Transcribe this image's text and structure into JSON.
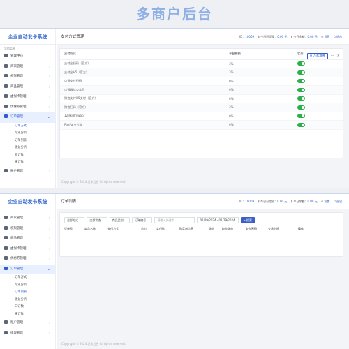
{
  "hero": {
    "title": "多商户后台"
  },
  "panel1": {
    "brand": "企业自动发卡系统",
    "nav_caption": "导航菜单",
    "nav": [
      {
        "label": "管理中心",
        "icon": "dashboard-icon",
        "chev": ""
      },
      {
        "label": "商家管理",
        "icon": "store-icon",
        "chev": "›"
      },
      {
        "label": "权限管理",
        "icon": "lock-icon",
        "chev": "›"
      },
      {
        "label": "商品管理",
        "icon": "box-icon",
        "chev": "›"
      },
      {
        "label": "虚拟卡管理",
        "icon": "card-icon",
        "chev": "›"
      },
      {
        "label": "优惠券管理",
        "icon": "coupon-icon",
        "chev": "›"
      },
      {
        "label": "订单管理",
        "icon": "order-icon",
        "chev": "⌄"
      }
    ],
    "sub": [
      "订单方式",
      "渠道分析",
      "订单列表",
      "收益分析",
      "日订数",
      "未订数"
    ],
    "nav_after": [
      {
        "label": "账户管理",
        "icon": "user-icon",
        "chev": "›"
      }
    ],
    "page_title": "支付方式管理",
    "topinfo": {
      "id_label": "ID：",
      "id_value": "10069",
      "profit_label": "$ 今日可提现：",
      "profit_value": "0.00 元",
      "balance_label": "$ 今日余额：",
      "balance_value": "0.00 元",
      "settings": "设置",
      "logout": "退出"
    },
    "add_button": "万家漏撞",
    "columns": [
      "支付方式",
      "平台税额",
      "状态"
    ],
    "rows": [
      {
        "name": "支付宝扫码（官方）",
        "fee": "3%"
      },
      {
        "name": "支付宝H5（官方）",
        "fee": "3%"
      },
      {
        "name": "点银支付扫码",
        "fee": "0%"
      },
      {
        "name": "点银微信公众号",
        "fee": "0%"
      },
      {
        "name": "微信支付H5支付（官方）",
        "fee": "0%"
      },
      {
        "name": "微信扫码（官方）",
        "fee": "3%"
      },
      {
        "name": "12lskj微Swap",
        "fee": "0%"
      },
      {
        "name": "PayPal支付宝",
        "fee": "0%"
      }
    ],
    "footer": "Copyright © 2024 发卡后台 All rights reserved."
  },
  "panel2": {
    "brand": "企业自动发卡系统",
    "nav": [
      {
        "label": "商家管理",
        "icon": "store-icon",
        "chev": "›"
      },
      {
        "label": "权限管理",
        "icon": "lock-icon",
        "chev": "›"
      },
      {
        "label": "商品管理",
        "icon": "box-icon",
        "chev": "›"
      },
      {
        "label": "虚拟卡管理",
        "icon": "card-icon",
        "chev": "›"
      },
      {
        "label": "优惠券管理",
        "icon": "coupon-icon",
        "chev": "›"
      },
      {
        "label": "订单管理",
        "icon": "order-icon",
        "chev": "⌄"
      }
    ],
    "sub": [
      "订单方式",
      "渠道分析",
      "订单列表",
      "收益分析",
      "日订数",
      "未订数"
    ],
    "nav_after": [
      {
        "label": "账户管理",
        "icon": "user-icon",
        "chev": "›"
      },
      {
        "label": "提现管理",
        "icon": "withdraw-icon",
        "chev": "›"
      }
    ],
    "page_title": "订单列表",
    "filters": {
      "pay_method": "全部方式",
      "status": "全部状态",
      "category": "商品类别",
      "order_no": "订单编号",
      "search_placeholder": "请输入关键字",
      "date_range": "01/29/2024 - 01/29/2024",
      "search_button": "搜索"
    },
    "columns": [
      "订单号",
      "商品名称",
      "支付方式",
      "总价",
      "实付款",
      "购买者信息",
      "状态",
      "取卡状态",
      "取卡密码",
      "交易时间",
      "操作"
    ],
    "footer": "Copyright © 2024 发卡后台 All rights reserved."
  }
}
